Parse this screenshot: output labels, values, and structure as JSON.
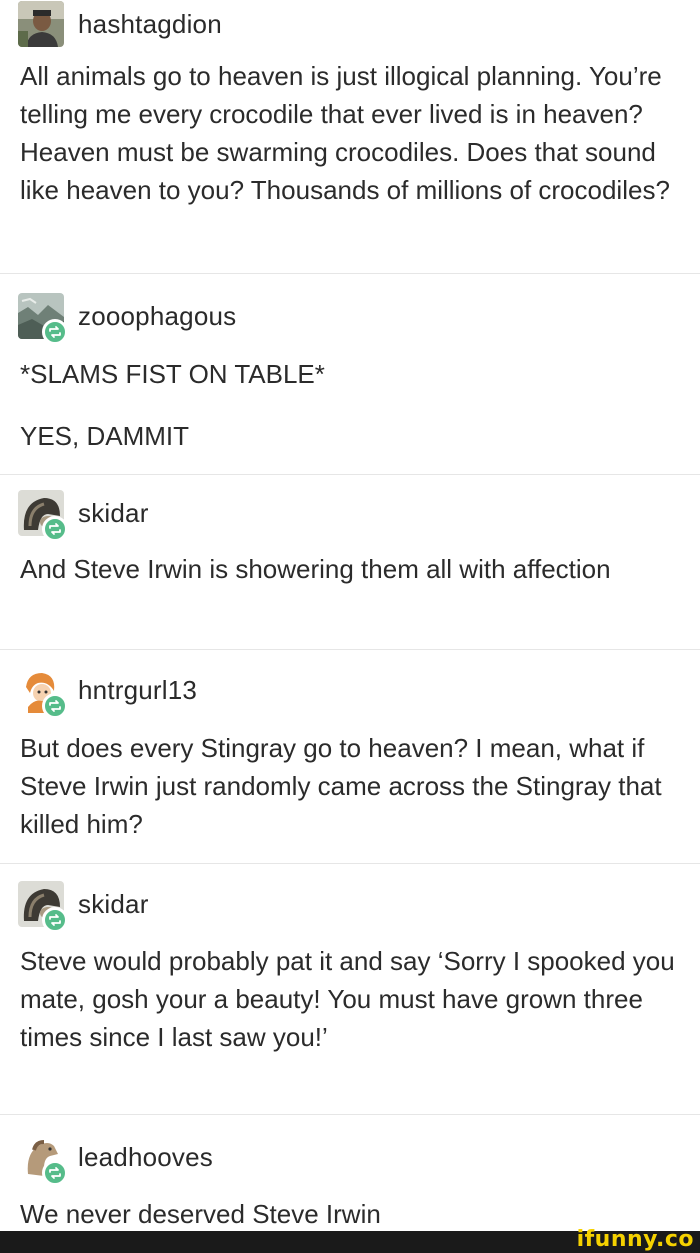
{
  "posts": [
    {
      "username": "hashtagdion",
      "avatar_icon": "person-avatar-icon",
      "reblog": false,
      "paragraphs": [
        "All animals go to heaven is just illogical planning. You’re telling me every crocodile that ever lived is in heaven? Heaven must be swarming crocodiles. Does that sound like heaven to you? Thousands of millions of crocodiles?"
      ]
    },
    {
      "username": "zooophagous",
      "avatar_icon": "landscape-avatar-icon",
      "reblog": true,
      "paragraphs": [
        "*SLAMS FIST ON TABLE*",
        "YES, DAMMIT"
      ]
    },
    {
      "username": "skidar",
      "avatar_icon": "helmet-avatar-icon",
      "reblog": true,
      "paragraphs": [
        "And Steve Irwin is showering them all with affection"
      ]
    },
    {
      "username": "hntrgurl13",
      "avatar_icon": "cartoon-avatar-icon",
      "reblog": true,
      "paragraphs": [
        "But does every Stingray go to heaven? I mean, what if Steve Irwin just randomly came across the Stingray that killed him?"
      ]
    },
    {
      "username": "skidar",
      "avatar_icon": "helmet-avatar-icon",
      "reblog": true,
      "paragraphs": [
        "Steve would probably pat it and say ‘Sorry I spooked you mate, gosh your a beauty! You must have grown three times since I last saw you!’"
      ]
    },
    {
      "username": "leadhooves",
      "avatar_icon": "horse-avatar-icon",
      "reblog": true,
      "paragraphs": [
        "We never deserved Steve Irwin"
      ]
    }
  ],
  "watermark": "ifunny.co",
  "colors": {
    "reblog_badge": "#56bc8a",
    "watermark": "#f5d100",
    "footer": "#1a1a1a"
  }
}
